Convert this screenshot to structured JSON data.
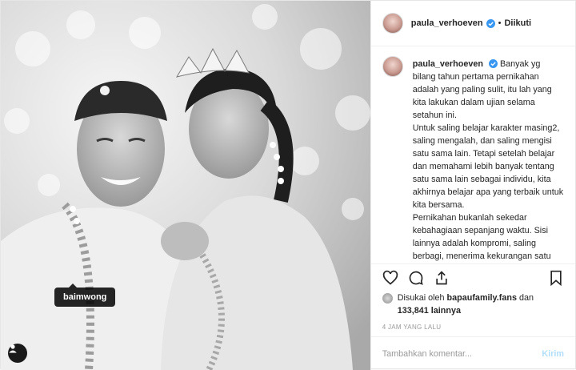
{
  "photo": {
    "tagged_user": "baimwong"
  },
  "header": {
    "username": "paula_verhoeven",
    "separator": "•",
    "follow_status": "Diikuti"
  },
  "caption": {
    "username": "paula_verhoeven",
    "paragraph_1": "Banyak yg bilang tahun pertama pernikahan adalah yang paling sulit, itu lah yang kita lakukan dalam ujian selama setahun ini.",
    "paragraph_2": "Untuk saling belajar karakter masing2, saling mengalah, dan saling mengisi satu sama lain. Tetapi setelah belajar dan memahami lebih banyak tentang satu sama lain sebagai individu, kita akhirnya belajar apa yang terbaik untuk kita bersama.",
    "paragraph_3": "Pernikahan bukanlah sekedar kebahagiaan sepanjang waktu. Sisi lainnya adalah kompromi, saling berbagi, menerima kekurangan satu sama lain dan selalu bersyukur, berdoa sm Allah, pasti Allah akan"
  },
  "actions": {
    "icons": [
      "heart-icon",
      "comment-icon",
      "share-icon",
      "bookmark-icon"
    ]
  },
  "likes": {
    "prefix": "Disukai oleh",
    "user": "bapaufamily.fans",
    "middle": "dan",
    "count": "133,841",
    "suffix": "lainnya"
  },
  "timestamp": "4 JAM YANG LALU",
  "comment": {
    "placeholder": "Tambahkan komentar...",
    "post_label": "Kirim"
  },
  "colors": {
    "verified_badge": "#3897f0",
    "post_button_disabled": "#b2dffc"
  }
}
